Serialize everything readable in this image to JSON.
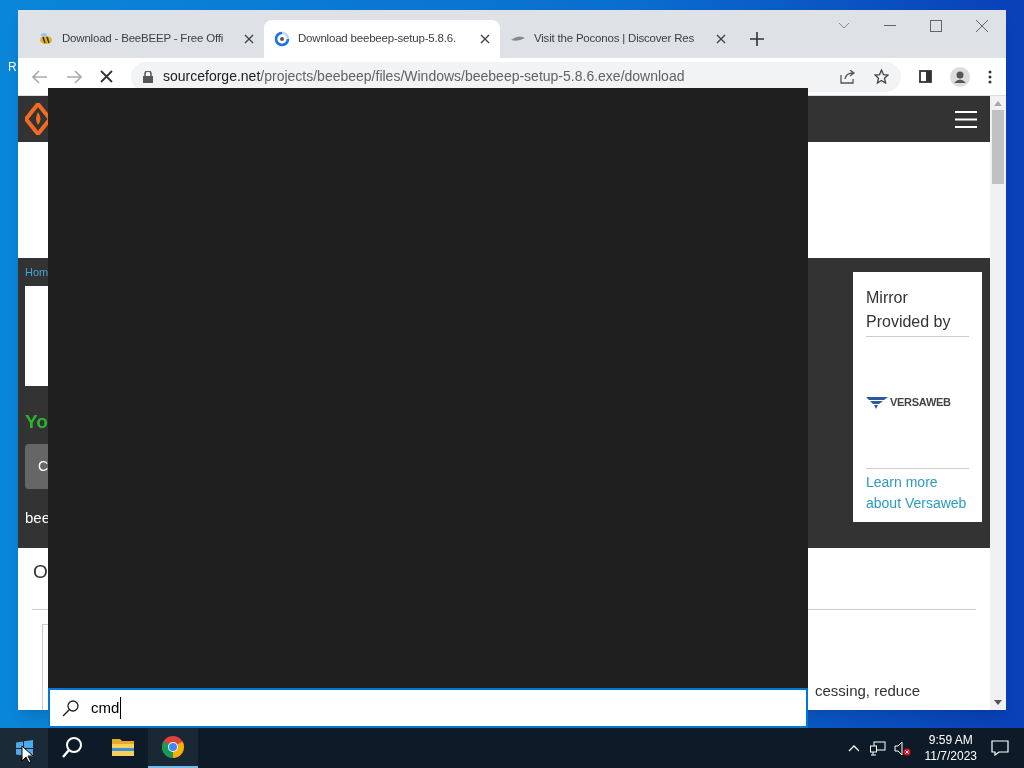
{
  "desktop": {
    "icon_label": "R"
  },
  "browser": {
    "tabs": [
      {
        "title": "Download - BeeBEEP - Free Offi",
        "selected": false,
        "kind": "bee"
      },
      {
        "title": "Download beebeep-setup-5.8.6.",
        "selected": true,
        "kind": "spinner"
      },
      {
        "title": "Visit the Poconos | Discover Res",
        "selected": false,
        "kind": "leaf"
      }
    ],
    "loading": true,
    "address": {
      "domain": "sourceforge.net",
      "path": "/projects/beebeep/files/Windows/beebeep-setup-5.8.6.exe/download"
    }
  },
  "page": {
    "breadcrumb": "Hom",
    "heading": "Yo",
    "button": "C",
    "filename": "bee",
    "mirror": {
      "title": "Mirror Provided by",
      "logo": "VERSAWEB",
      "link": "Learn more about Versaweb"
    },
    "section_heading": "O",
    "body_text": "cessing, reduce"
  },
  "start_search": {
    "value": "cmd"
  },
  "taskbar": {
    "apps": [
      {
        "kind": "search",
        "selected": false
      },
      {
        "kind": "folder",
        "selected": false
      },
      {
        "kind": "chrome",
        "selected": true
      }
    ],
    "clock": {
      "time": "9:59 AM",
      "date": "11/7/2023"
    }
  }
}
